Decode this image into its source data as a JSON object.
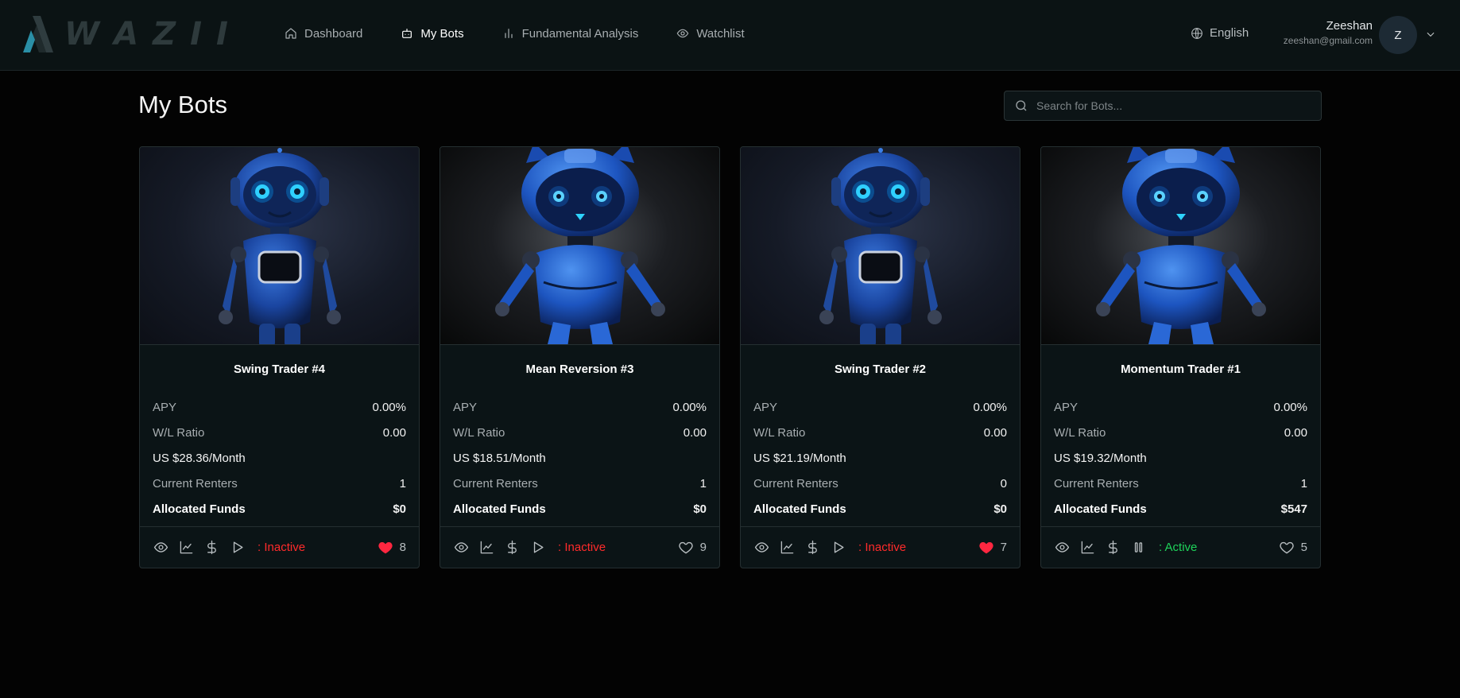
{
  "brand": {
    "name": "WAZII",
    "logo_letters": [
      "W",
      "A",
      "Z",
      "I",
      "I"
    ]
  },
  "nav": [
    {
      "label": "Dashboard",
      "icon": "home-icon",
      "active": false
    },
    {
      "label": "My Bots",
      "icon": "bot-icon",
      "active": true
    },
    {
      "label": "Fundamental Analysis",
      "icon": "bar-chart-icon",
      "active": false
    },
    {
      "label": "Watchlist",
      "icon": "eye-icon",
      "active": false
    }
  ],
  "language": {
    "label": "English",
    "icon": "globe-icon"
  },
  "user": {
    "name": "Zeeshan",
    "email": "zeeshan@gmail.com",
    "initial": "Z"
  },
  "page": {
    "title": "My Bots"
  },
  "search": {
    "placeholder": "Search for Bots...",
    "value": ""
  },
  "labels": {
    "apy": "APY",
    "wl": "W/L Ratio",
    "renters": "Current Renters",
    "funds": "Allocated Funds",
    "status_sep": ":"
  },
  "colors": {
    "inactive": "#ff2b2b",
    "active": "#1ed35a",
    "liked": "#ff2740"
  },
  "bots": [
    {
      "name": "Swing Trader #4",
      "image": "robot-headphones",
      "apy": "0.00%",
      "wl": "0.00",
      "price": "US $28.36/Month",
      "renters": "1",
      "funds": "$0",
      "status": "Inactive",
      "liked": true,
      "likes": "8",
      "running": false
    },
    {
      "name": "Mean Reversion #3",
      "image": "robot-cat-ears",
      "apy": "0.00%",
      "wl": "0.00",
      "price": "US $18.51/Month",
      "renters": "1",
      "funds": "$0",
      "status": "Inactive",
      "liked": false,
      "likes": "9",
      "running": false
    },
    {
      "name": "Swing Trader #2",
      "image": "robot-headphones",
      "apy": "0.00%",
      "wl": "0.00",
      "price": "US $21.19/Month",
      "renters": "0",
      "funds": "$0",
      "status": "Inactive",
      "liked": true,
      "likes": "7",
      "running": false
    },
    {
      "name": "Momentum Trader #1",
      "image": "robot-cat-ears",
      "apy": "0.00%",
      "wl": "0.00",
      "price": "US $19.32/Month",
      "renters": "1",
      "funds": "$547",
      "status": "Active",
      "liked": false,
      "likes": "5",
      "running": true
    }
  ]
}
